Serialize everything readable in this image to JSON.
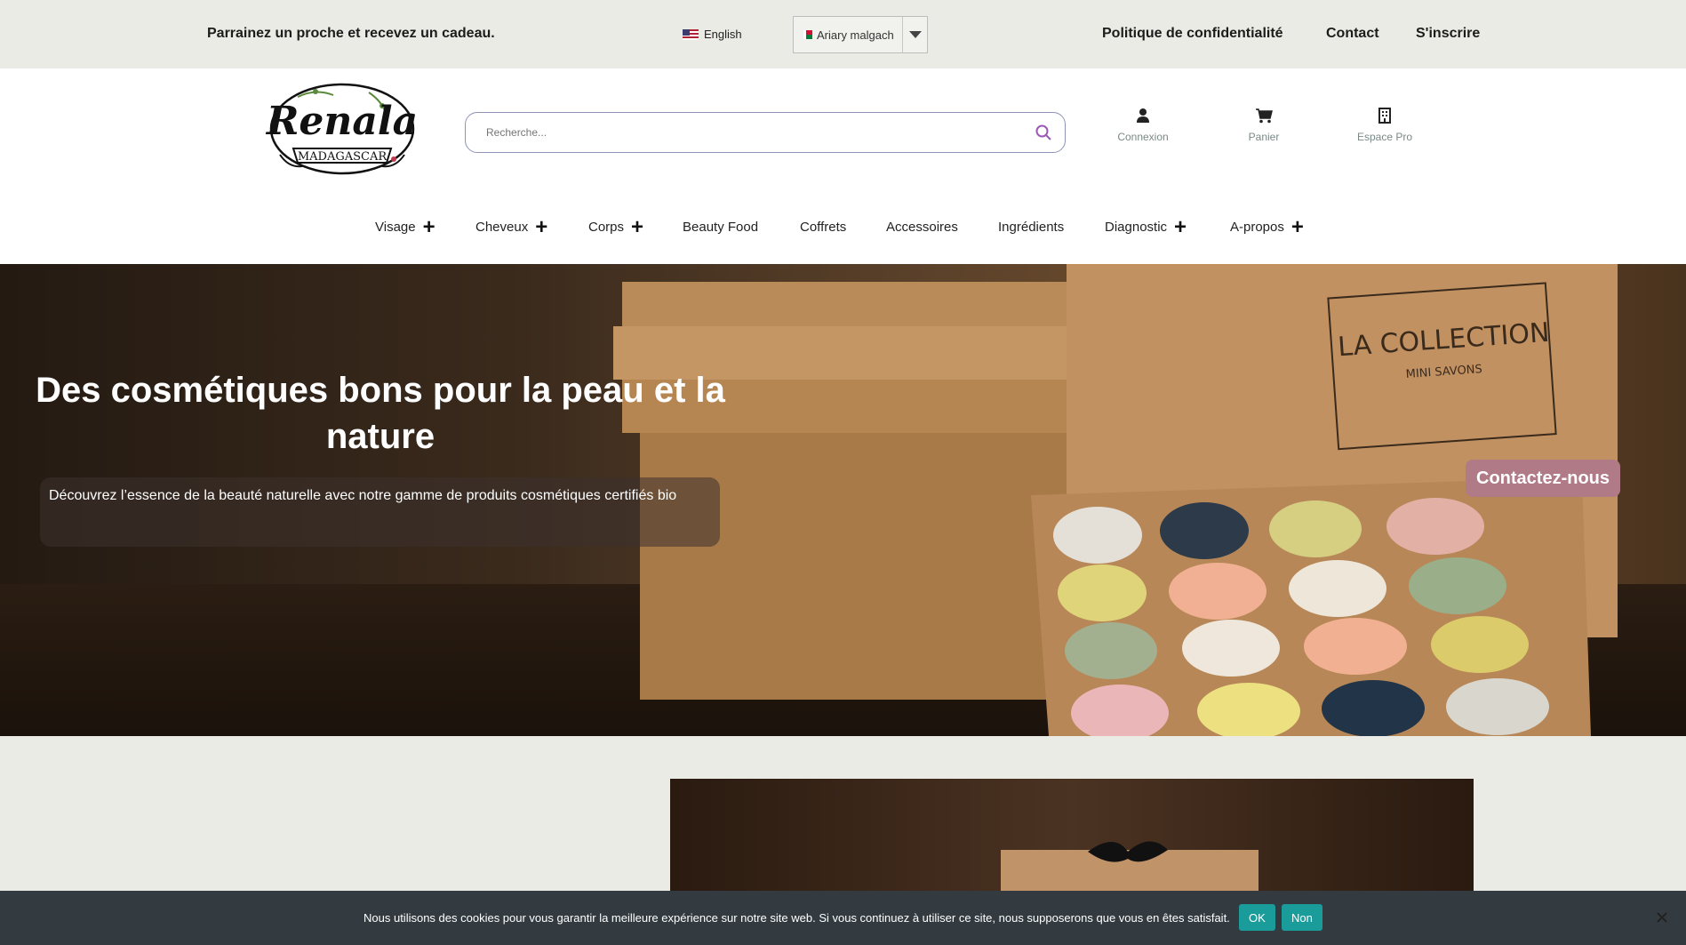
{
  "topbar": {
    "promo": "Parrainez un proche et recevez un cadeau.",
    "language": "English",
    "currency": "Ariary malgach",
    "links": [
      "Politique de confidentialité",
      "Contact",
      "S'inscrire"
    ]
  },
  "header": {
    "logo_text": "Renala",
    "logo_subtext": "MADAGASCAR",
    "search_placeholder": "Recherche...",
    "account_label": "Connexion",
    "cart_label": "Panier",
    "pro_label": "Espace Pro"
  },
  "nav": {
    "items": [
      {
        "label": "Visage",
        "expandable": true
      },
      {
        "label": "Cheveux",
        "expandable": true
      },
      {
        "label": "Corps",
        "expandable": true
      },
      {
        "label": "Beauty Food",
        "expandable": false
      },
      {
        "label": "Coffrets",
        "expandable": false
      },
      {
        "label": "Accessoires",
        "expandable": false
      },
      {
        "label": "Ingrédients",
        "expandable": false
      },
      {
        "label": "Diagnostic",
        "expandable": true
      },
      {
        "label": "A-propos",
        "expandable": true
      }
    ]
  },
  "hero": {
    "title": "Des cosmétiques bons pour la peau et la nature",
    "subtitle": "Découvrez l’essence de la beauté naturelle avec notre gamme de produits cosmétiques certifiés bio",
    "cta": "Contactez-nous",
    "box_title": "LA COLLECTION",
    "box_subtitle": "MINI SAVONS"
  },
  "cookie": {
    "message": "Nous utilisons des cookies pour vous garantir la meilleure expérience sur notre site web. Si vous continuez à utiliser ce site, nous supposerons que vous en êtes satisfait.",
    "ok": "OK",
    "no": "Non"
  },
  "colors": {
    "topbar_bg": "#e9ebe4",
    "accent_pink": "#b07a87",
    "cookie_bg": "#333b40",
    "cookie_button": "#1a9c9a",
    "search_icon": "#9b59b6"
  }
}
